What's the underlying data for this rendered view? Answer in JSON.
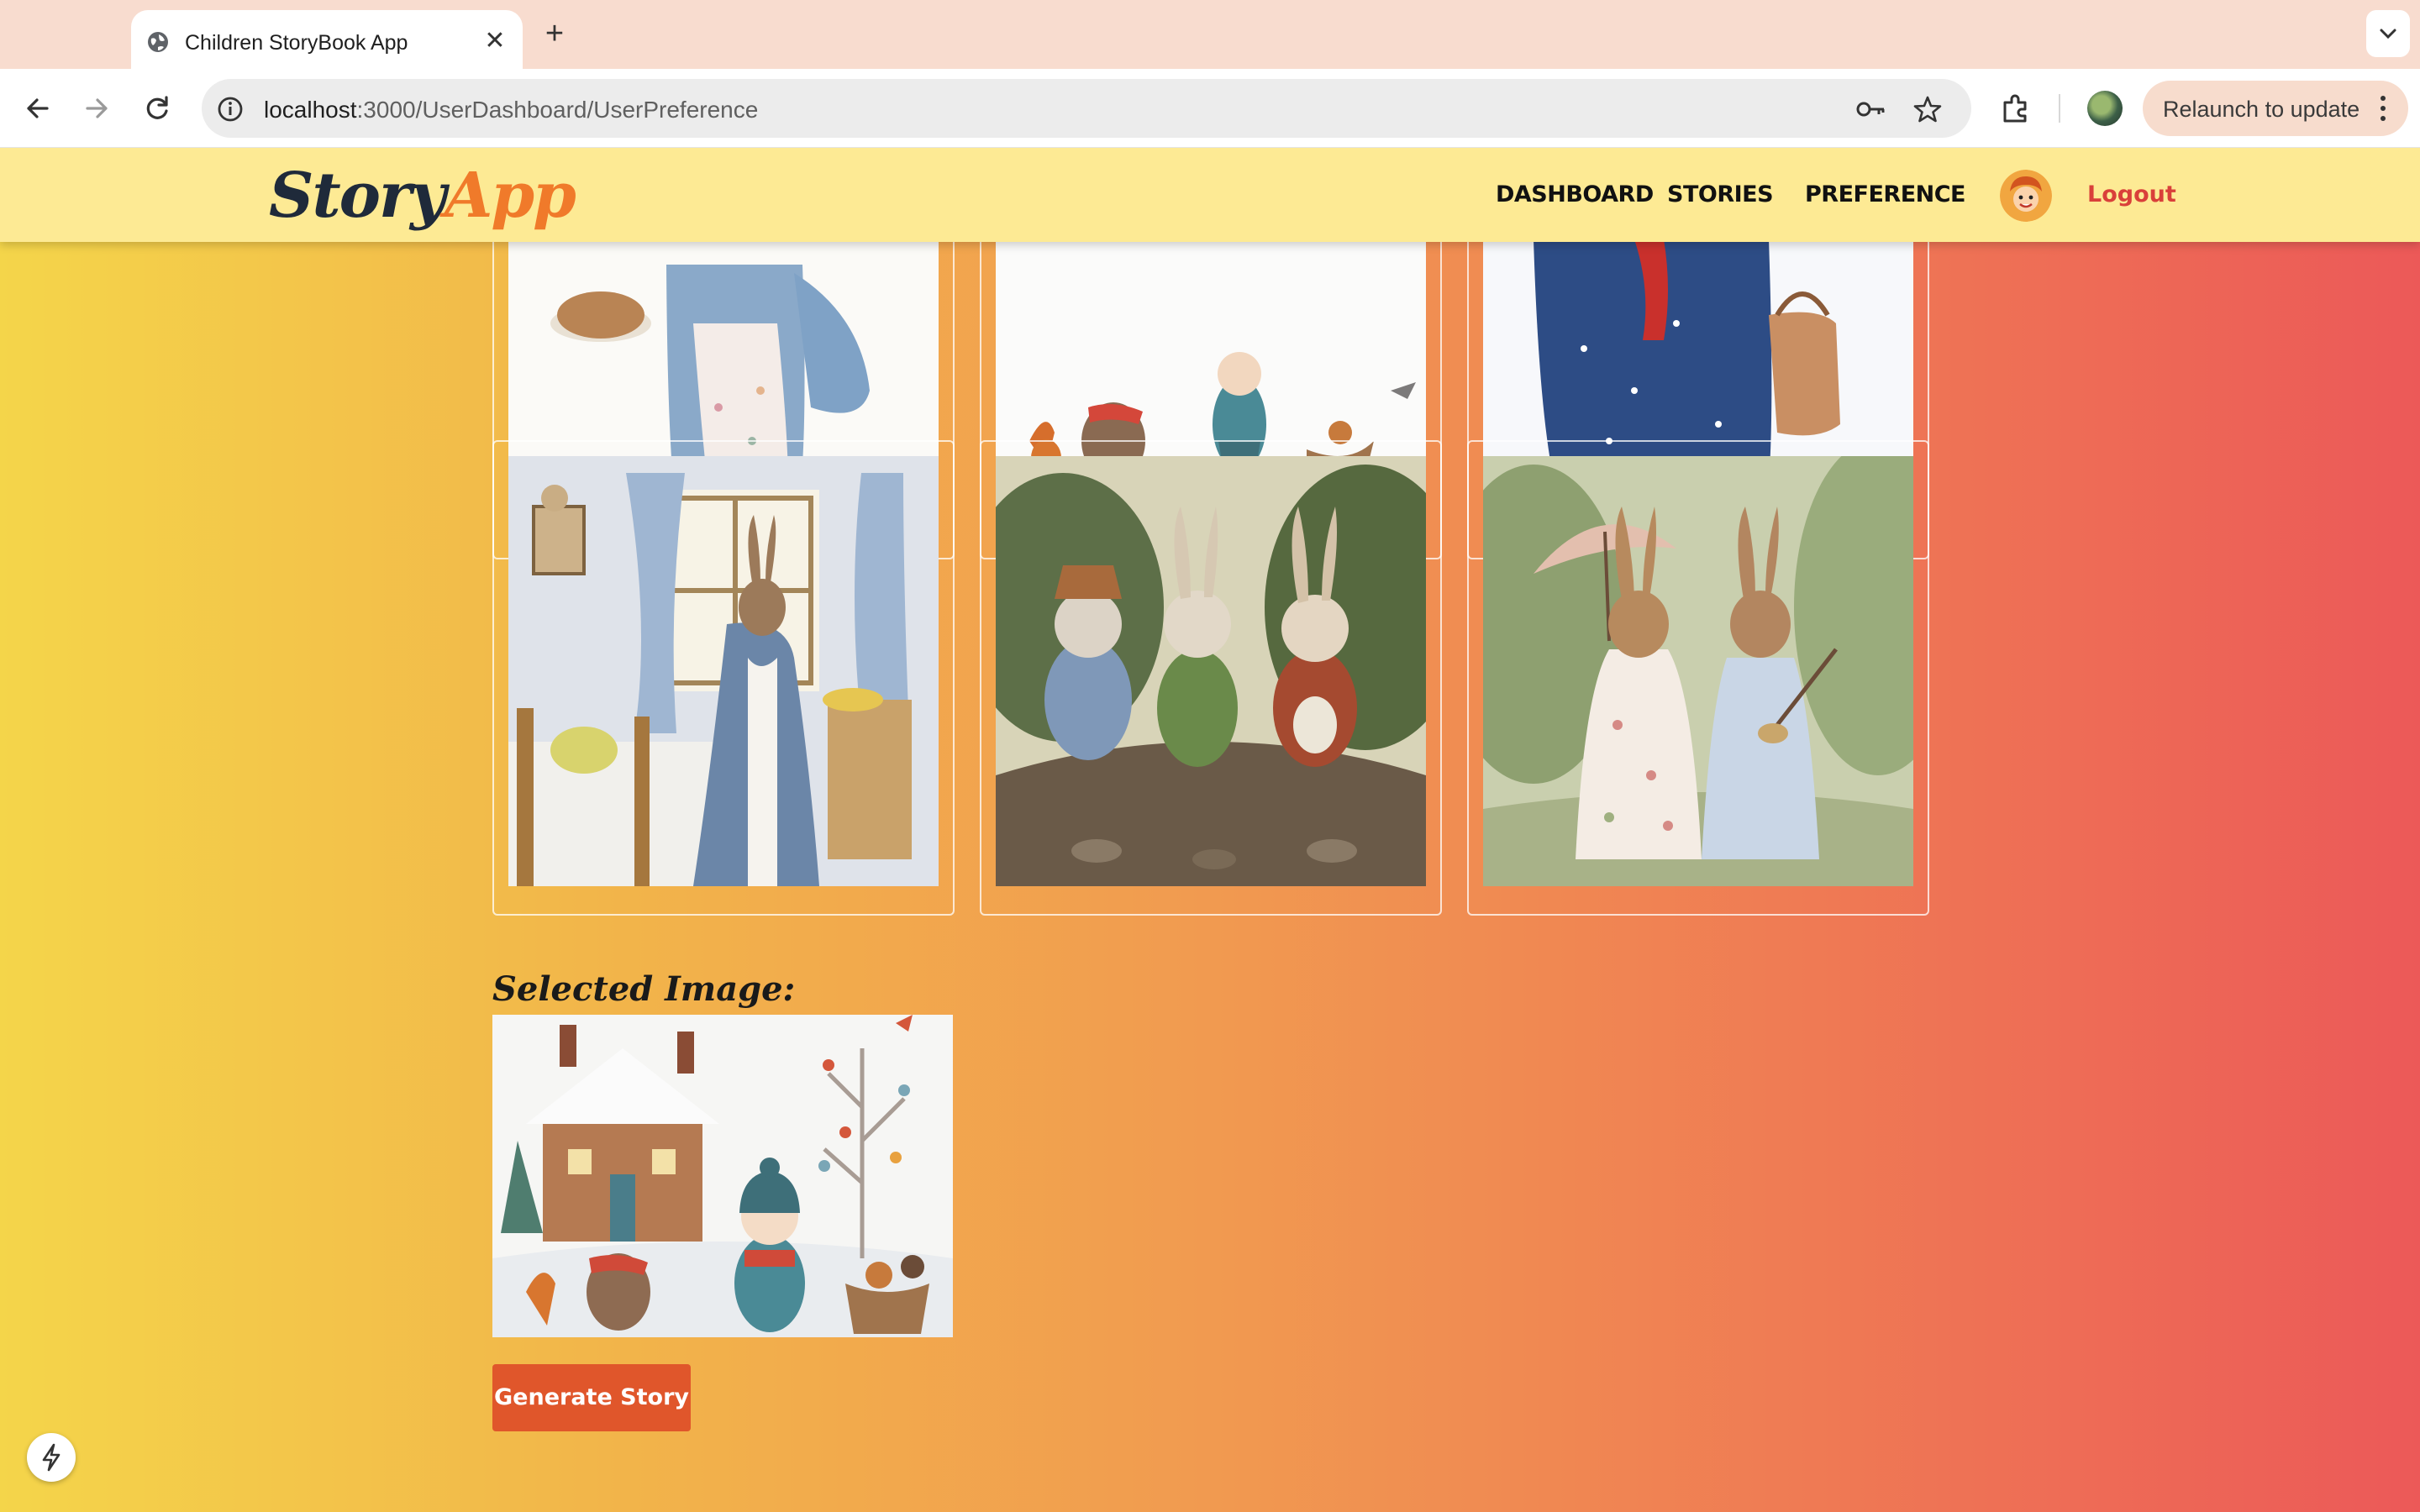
{
  "browser": {
    "tab_title": "Children StoryBook App",
    "tab_close": "✕",
    "new_tab": "+",
    "url_host": "localhost",
    "url_rest": ":3000/UserDashboard/UserPreference",
    "relaunch_label": "Relaunch to update"
  },
  "header": {
    "logo_part1": "Story",
    "logo_part2": "App",
    "nav": [
      "DASHBOARD",
      "STORIES",
      "PREFERENCE"
    ],
    "logout_label": "Logout"
  },
  "gallery": {
    "images": [
      "bear-with-cake-icon",
      "winter-animals-sled-icon",
      "bear-in-blue-coat-icon",
      "rabbit-in-bedroom-icon",
      "three-rabbits-walking-icon",
      "two-rabbits-with-umbrella-icon"
    ]
  },
  "selected": {
    "title": "Selected Image:",
    "image": "winter-cottage-scene-icon"
  },
  "generate_label": "Generate Story",
  "colors": {
    "header_bg": "#fdea94",
    "accent": "#e0562b",
    "logout": "#d9403a",
    "logo_dark": "#1f2a3a",
    "logo_orange": "#f07a2a"
  }
}
